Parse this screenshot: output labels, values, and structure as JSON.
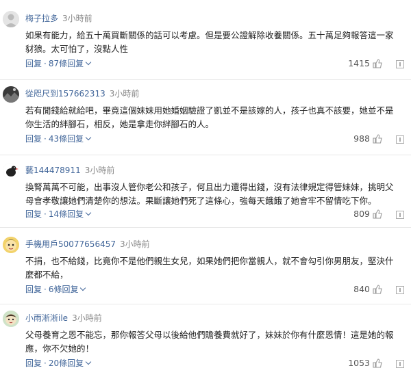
{
  "comments": [
    {
      "username": "梅子拉多",
      "time": "3小時前",
      "text": "如果有能力，給五十萬買斷關係的話可以考慮。但是要公證解除收養關係。五十萬足夠報答這一家豺狼。太可怕了，沒點人性",
      "reply_label": "回复",
      "reply_count_label": "87條回复",
      "likes": "1415",
      "avatar_icon": "default-avatar-icon"
    },
    {
      "username": "從咫尺到157662313",
      "time": "3小時前",
      "text": "若有閒錢給就給吧，畢竟這個妹妹用她婚姻驗證了凱並不是該嫁的人，孩子也真不該要，她並不是你生活的絆腳石，相反，她是拿走你絆腳石的人。",
      "reply_label": "回复",
      "reply_count_label": "43條回复",
      "likes": "988",
      "avatar_icon": "landscape-avatar-icon"
    },
    {
      "username": "藝144478911",
      "time": "3小時前",
      "text": "換腎萬萬不可能，出事沒人管你老公和孩子，何且出力還得出錢，沒有法律規定得管妹妹，挑明父母會孝敬讓她們清楚你的想法。果斷讓她們死了這條心，強每天餓餓了她會牢不留情吃下你。",
      "reply_label": "回复",
      "reply_count_label": "14條回复",
      "likes": "809",
      "avatar_icon": "bird-avatar-icon"
    },
    {
      "username": "手機用戶50077656457",
      "time": "3小時前",
      "text": "不捐，也不給錢，比竟你不是他們親生女兒，如果她們把你當親人，就不會勾引你男朋友，堅決什麼都不給，",
      "reply_label": "回复",
      "reply_count_label": "6條回复",
      "likes": "840",
      "avatar_icon": "cartoon-avatar-icon"
    },
    {
      "username": "小雨淅淅ile",
      "time": "3小時前",
      "text": "父母養育之恩不能忘，那你報答父母以後給他們贍養費就好了，妹妹於你有什麼恩情！這是她的報應，你不欠她的！",
      "reply_label": "回复",
      "reply_count_label": "20條回复",
      "likes": "1053",
      "avatar_icon": "cartoon-face-avatar-icon"
    }
  ],
  "colors": {
    "link": "#406599",
    "text": "#222222",
    "muted": "#888888",
    "divider": "#e8e8e8"
  }
}
